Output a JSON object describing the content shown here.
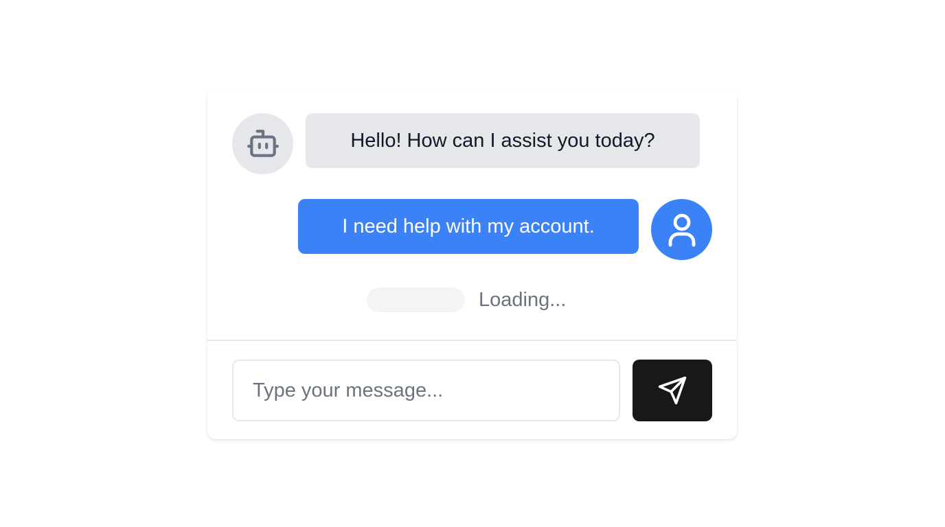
{
  "messages": {
    "bot_greeting": "Hello! How can I assist you today?",
    "user_message": "I need help with my account.",
    "loading_text": "Loading..."
  },
  "composer": {
    "placeholder": "Type your message...",
    "value": ""
  },
  "icons": {
    "bot_avatar": "robot-icon",
    "user_avatar": "user-icon",
    "send": "send-icon"
  },
  "colors": {
    "bot_bubble": "#e5e7eb",
    "user_bubble": "#3b82f6",
    "send_button": "#18181b",
    "muted_text": "#6b7280"
  }
}
